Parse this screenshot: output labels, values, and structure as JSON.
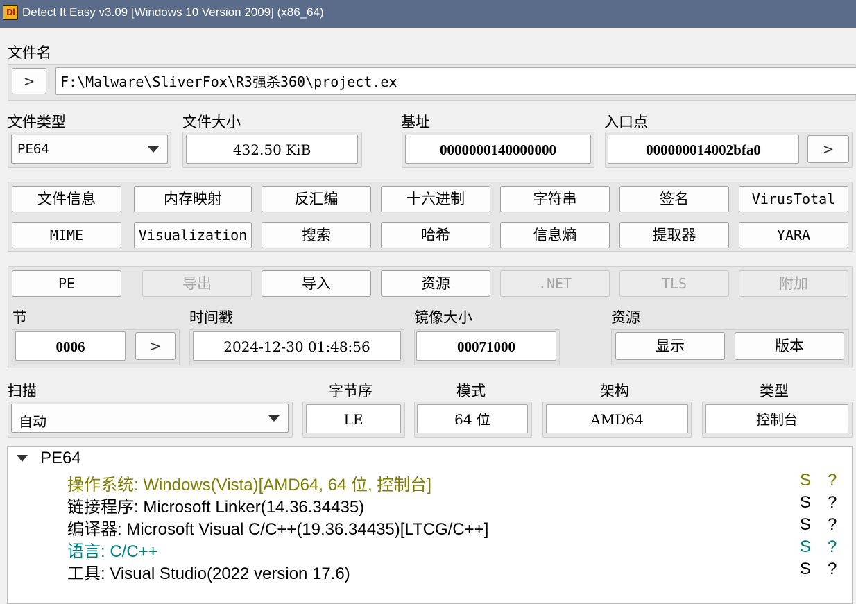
{
  "window": {
    "title": "Detect It Easy v3.09 [Windows 10 Version 2009] (x86_64)",
    "icon_text": "Di"
  },
  "file": {
    "label": "文件名",
    "path": "F:\\Malware\\SliverFox\\R3强杀360\\project.ex",
    "browse_btn": ">"
  },
  "info": {
    "file_type_label": "文件类型",
    "file_type_value": "PE64",
    "file_size_label": "文件大小",
    "file_size_value": "432.50 KiB",
    "base_label": "基址",
    "base_value": "0000000140000000",
    "entry_label": "入口点",
    "entry_value": "000000014002bfa0",
    "entry_btn": ">"
  },
  "tools": {
    "row1": [
      "文件信息",
      "内存映射",
      "反汇编",
      "十六进制",
      "字符串",
      "签名",
      "VirusTotal"
    ],
    "row2": [
      "MIME",
      "Visualization",
      "搜索",
      "哈希",
      "信息熵",
      "提取器",
      "YARA"
    ]
  },
  "pe": {
    "buttons": [
      "PE",
      "导出",
      "导入",
      "资源",
      ".NET",
      "TLS",
      "附加"
    ],
    "sections_label": "节",
    "sections_value": "0006",
    "sections_btn": ">",
    "timestamp_label": "时间戳",
    "timestamp_value": "2024-12-30 01:48:56",
    "image_size_label": "镜像大小",
    "image_size_value": "00071000",
    "resources_label": "资源",
    "resources_show": "显示",
    "resources_version": "版本"
  },
  "scan": {
    "label": "扫描",
    "mode_value": "自动",
    "endian_label": "字节序",
    "endian_value": "LE",
    "mode_label": "模式",
    "bits_value": "64 位",
    "arch_label": "架构",
    "arch_value": "AMD64",
    "type_label": "类型",
    "type_value": "控制台"
  },
  "results": {
    "root": "PE64",
    "rows": [
      {
        "text": "操作系统: Windows(Vista)[AMD64, 64 位, 控制台]",
        "s": "S",
        "q": "?",
        "color": "#7f7f00"
      },
      {
        "text": "链接程序: Microsoft Linker(14.36.34435)",
        "s": "S",
        "q": "?",
        "color": "#000000"
      },
      {
        "text": "编译器: Microsoft Visual C/C++(19.36.34435)[LTCG/C++]",
        "s": "S",
        "q": "?",
        "color": "#000000"
      },
      {
        "text": "语言: C/C++",
        "s": "S",
        "q": "?",
        "color": "#008080"
      },
      {
        "text": "工具: Visual Studio(2022 version 17.6)",
        "s": "S",
        "q": "?",
        "color": "#000000"
      }
    ]
  }
}
